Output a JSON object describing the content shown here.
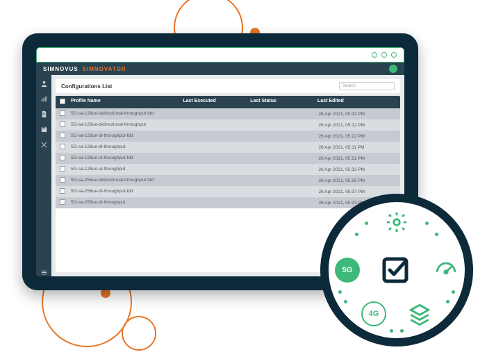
{
  "brand": {
    "name1": "SIMNOVUS",
    "name2": "SIMNOVATOR"
  },
  "list": {
    "title": "Configurations List",
    "search_placeholder": "Search",
    "columns": {
      "profile": "Profile Name",
      "executed": "Last Executed",
      "status": "Last Status",
      "edited": "Last Edited"
    },
    "rows": [
      {
        "name": "5G-sa-128ue-bidirectional-throughput-fdd",
        "edited": "26 Apr 2021, 05:23 PM"
      },
      {
        "name": "5G-sa-128ue-bidirectional-throughput",
        "edited": "26 Apr 2021, 05:12 PM"
      },
      {
        "name": "5G-sa-128ue-dl-throughput-fdd",
        "edited": "26 Apr 2021, 05:22 PM"
      },
      {
        "name": "5G-sa-128ue-dl-throughput",
        "edited": "26 Apr 2021, 05:11 PM"
      },
      {
        "name": "5G-sa-128ue-ul-throughput-fdd",
        "edited": "26 Apr 2021, 05:21 PM"
      },
      {
        "name": "5G-sa-128ue-ul-throughput",
        "edited": "26 Apr 2021, 05:32 PM"
      },
      {
        "name": "5G-sa-256ue-bidirectional-throughput-fdd",
        "edited": "26 Apr 2021, 05:25 PM"
      },
      {
        "name": "5G-sa-256ue-dl-throughput-fdd",
        "edited": "26 Apr 2021, 05:37 PM"
      },
      {
        "name": "5G-sa-256ue-dl-throughput",
        "edited": "26 Apr 2021, 05:23 PM"
      }
    ]
  },
  "feature_badges": {
    "fiveg": "5G",
    "fourg": "4G"
  }
}
